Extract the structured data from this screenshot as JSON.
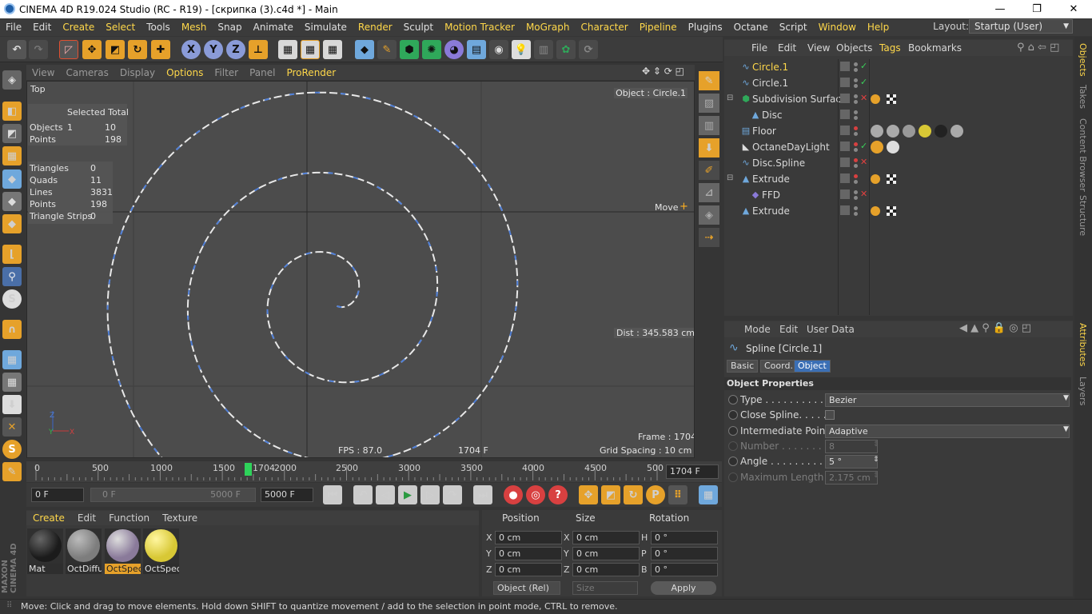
{
  "window": {
    "title": "CINEMA 4D R19.024 Studio (RC - R19) - [скрипка (3).c4d *] - Main",
    "minimize": "—",
    "restore": "❐",
    "close": "✕"
  },
  "menubar": {
    "items": [
      "File",
      "Edit",
      "Create",
      "Select",
      "Tools",
      "Mesh",
      "Snap",
      "Animate",
      "Simulate",
      "Sculpt",
      "Render",
      "Sculpt",
      "Motion Tracker",
      "MoGraph",
      "Character",
      "Pipeline",
      "Plugins",
      "Octane",
      "Script",
      "Window",
      "Help"
    ],
    "items_real": [
      "File",
      "Edit",
      "Create",
      "Select",
      "Tools",
      "Mesh",
      "Snap",
      "Animate",
      "Simulate",
      "Render",
      "Sculpt",
      "Motion Tracker",
      "MoGraph",
      "Character",
      "Pipeline",
      "Plugins",
      "Octane",
      "Script",
      "Window",
      "Help"
    ],
    "layout_label": "Layout:",
    "layout_value": "Startup (User)"
  },
  "toolbar": {
    "axis_x": "X",
    "axis_y": "Y",
    "axis_z": "Z"
  },
  "viewport": {
    "menu": [
      "View",
      "Cameras",
      "Display",
      "Options",
      "Filter",
      "Panel",
      "ProRender"
    ],
    "camera": "Top",
    "object_label": "Object : Circle.1",
    "stats": {
      "header": "Selected Total",
      "rows": [
        {
          "k": "Objects",
          "sel": "1",
          "total": "10"
        },
        {
          "k": "Points",
          "sel": "",
          "total": "198"
        }
      ]
    },
    "stats2": [
      {
        "k": "Triangles",
        "v": "0"
      },
      {
        "k": "Quads",
        "v": "11"
      },
      {
        "k": "Lines",
        "v": "3831"
      },
      {
        "k": "Points",
        "v": "198"
      },
      {
        "k": "Triangle Strips",
        "v": "0"
      }
    ],
    "move_label": "Move",
    "dist_label": "Dist : 345.583 cm",
    "frame_label": "Frame : 1704",
    "fps_label": "FPS : 87.0",
    "frame_f": "1704 F",
    "grid_label": "Grid Spacing : 10 cm"
  },
  "timeline": {
    "ticks": [
      "0",
      "500",
      "1000",
      "1500",
      "2000",
      "2500",
      "3000",
      "3500",
      "4000",
      "4500",
      "500"
    ],
    "current": "1704",
    "current_field": "1704 F"
  },
  "transport": {
    "start": "0 F",
    "range_start": "0 F",
    "range_end": "5000 F",
    "end": "5000 F"
  },
  "materials": {
    "tabs": [
      "Create",
      "Edit",
      "Function",
      "Texture"
    ],
    "items": [
      {
        "label": "Mat",
        "color": "#1b1b1b"
      },
      {
        "label": "OctDiffu",
        "color": "#7d7d7d"
      },
      {
        "label": "OctSpec",
        "color": "#8a7a9a"
      },
      {
        "label": "OctSpec",
        "color": "#d8c835"
      }
    ]
  },
  "coords": {
    "headers": [
      "Position",
      "Size",
      "Rotation"
    ],
    "rows": [
      {
        "a": "X",
        "av": "0 cm",
        "b": "X",
        "bv": "0 cm",
        "c": "H",
        "cv": "0 °"
      },
      {
        "a": "Y",
        "av": "0 cm",
        "b": "Y",
        "bv": "0 cm",
        "c": "P",
        "cv": "0 °"
      },
      {
        "a": "Z",
        "av": "0 cm",
        "b": "Z",
        "bv": "0 cm",
        "c": "B",
        "cv": "0 °"
      }
    ],
    "mode": "Object (Rel)",
    "size_mode": "Size",
    "apply": "Apply"
  },
  "objects": {
    "menu": [
      "File",
      "Edit",
      "View",
      "Objects",
      "Tags",
      "Bookmarks"
    ],
    "rows": [
      {
        "name": "Circle.1",
        "selected": true,
        "icon": "spline",
        "check": "green"
      },
      {
        "name": "Circle.1",
        "selected": false,
        "icon": "spline",
        "check": "green"
      },
      {
        "name": "Subdivision Surface",
        "selected": false,
        "icon": "subd",
        "check": "red"
      },
      {
        "name": "Disc",
        "selected": false,
        "icon": "disc",
        "check": ""
      },
      {
        "name": "Floor",
        "selected": false,
        "icon": "floor",
        "check": ""
      },
      {
        "name": "OctaneDayLight",
        "selected": false,
        "icon": "light",
        "check": "green"
      },
      {
        "name": "Disc.Spline",
        "selected": false,
        "icon": "spline",
        "check": "red"
      },
      {
        "name": "Extrude",
        "selected": false,
        "icon": "extrude",
        "check": ""
      },
      {
        "name": "FFD",
        "selected": false,
        "icon": "ffd",
        "check": "red"
      },
      {
        "name": "Extrude",
        "selected": false,
        "icon": "extrude",
        "check": ""
      }
    ]
  },
  "attributes": {
    "menu": [
      "Mode",
      "Edit",
      "User Data"
    ],
    "title": "Spline [Circle.1]",
    "tabs": [
      "Basic",
      "Coord.",
      "Object"
    ],
    "section": "Object Properties",
    "props": [
      {
        "label": "Type . . . . . . . . . . . .",
        "value": "Bezier",
        "dim": false
      },
      {
        "label": "Close Spline. . . . . .",
        "value": "",
        "dim": false
      },
      {
        "label": "Intermediate Points",
        "value": "Adaptive",
        "dim": false
      },
      {
        "label": "Number . . . . . . . . .",
        "value": "8",
        "dim": true
      },
      {
        "label": "Angle . . . . . . . . . . .",
        "value": "5 °",
        "dim": false
      },
      {
        "label": "Maximum Length  .",
        "value": "2.175 cm",
        "dim": true
      }
    ]
  },
  "sidetabs": {
    "objects": "Objects",
    "takes": "Takes",
    "content": "Content Browser",
    "structure": "Structure",
    "attributes": "Attributes",
    "layers": "Layers"
  },
  "status": "Move: Click and drag to move elements. Hold down SHIFT to quantize movement / add to the selection in point mode, CTRL to remove.",
  "brand": "MAXON CINEMA 4D"
}
